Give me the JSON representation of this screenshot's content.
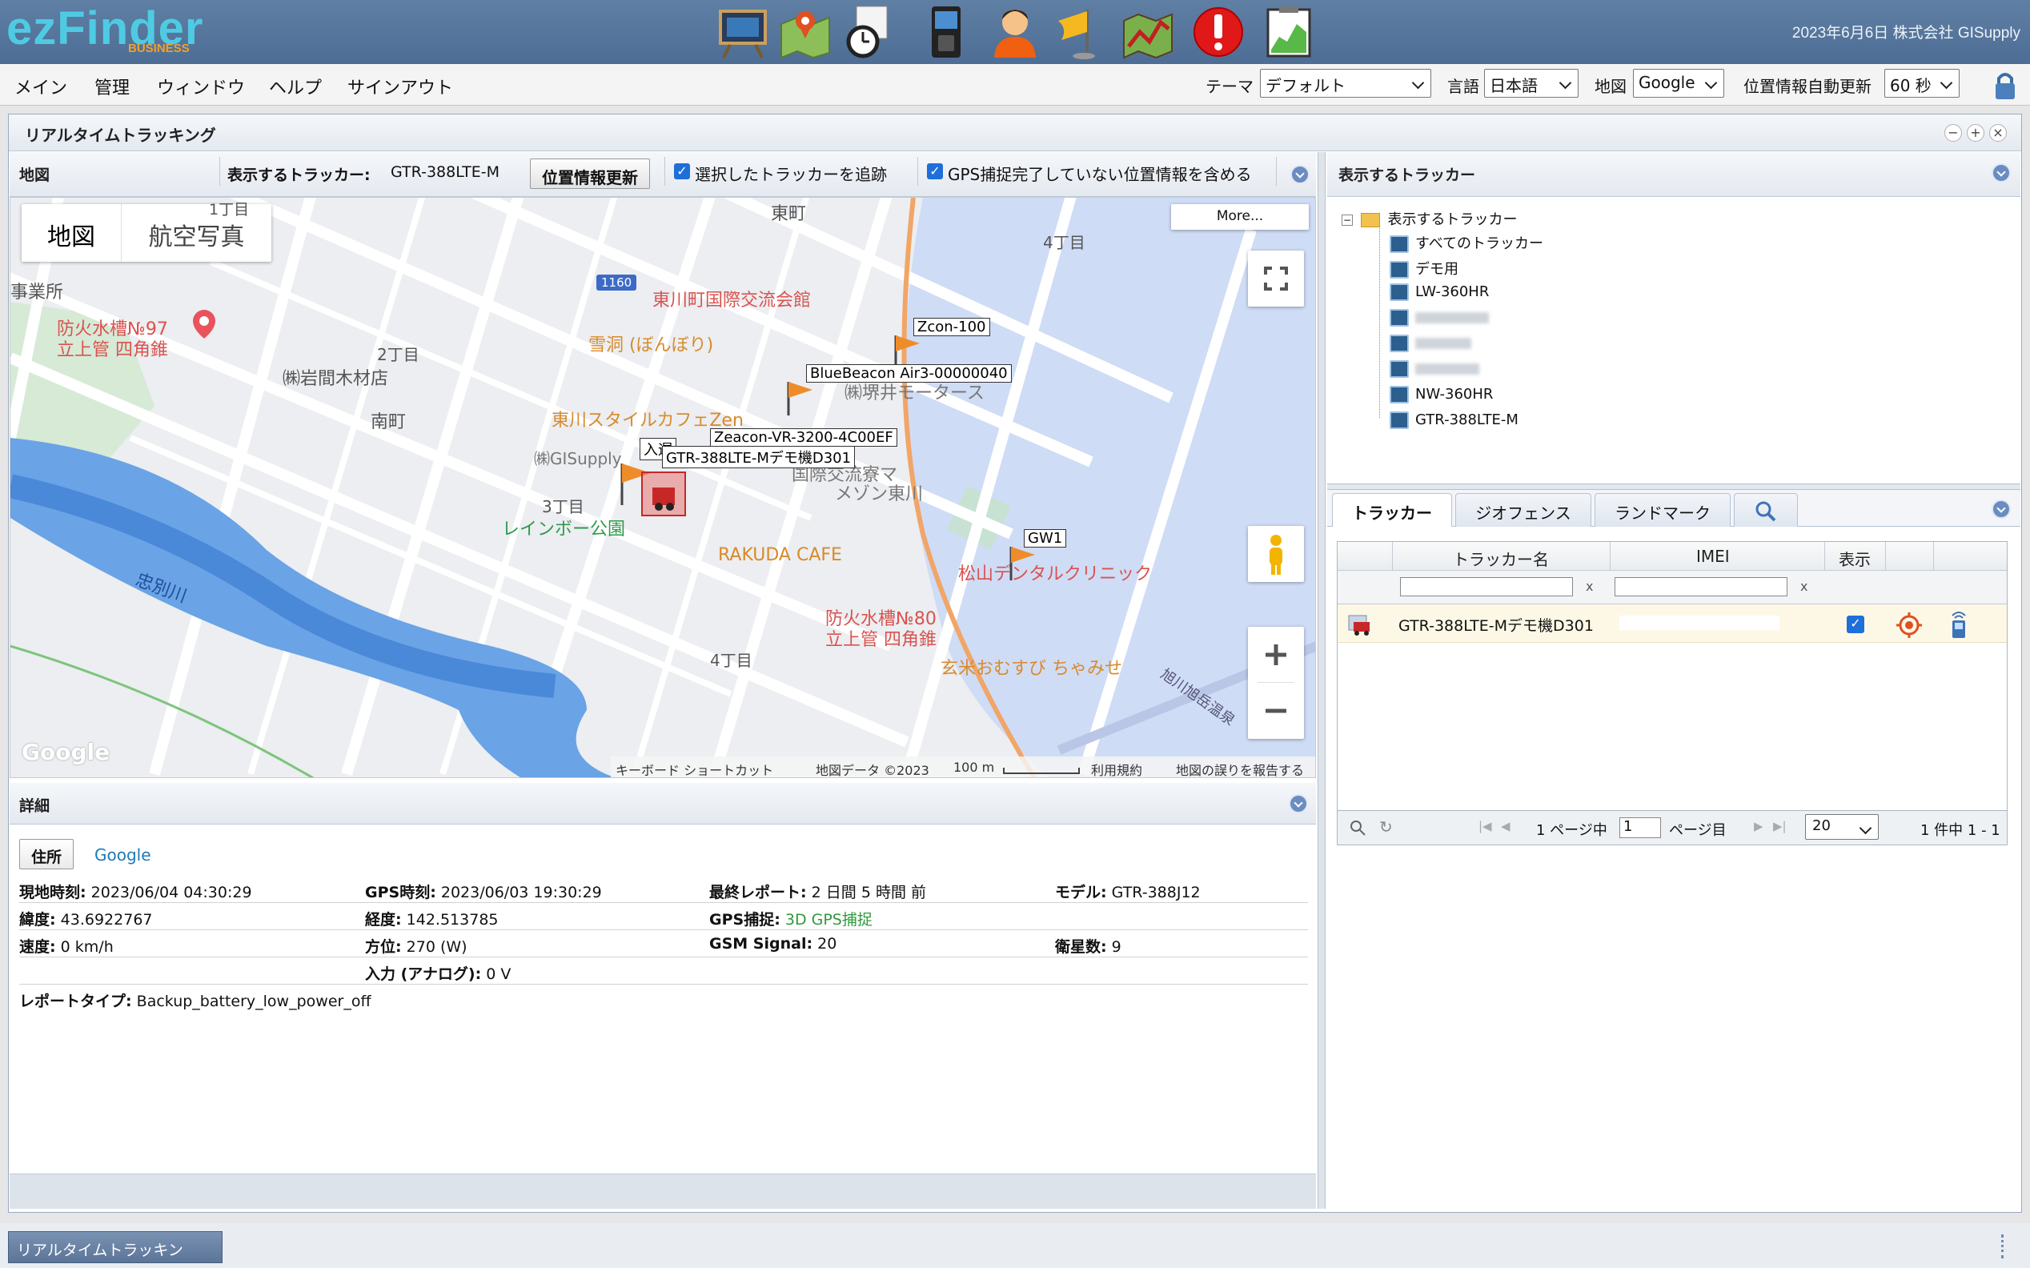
{
  "header": {
    "logo": "ezFinder",
    "logo_sub": "BUSINESS",
    "date_company": "2023年6月6日 株式会社 GISupply",
    "icons": [
      "presentation-board-icon",
      "map-pin-icon",
      "stopwatch-icon",
      "gps-device-icon",
      "user-icon",
      "flag-icon",
      "route-map-icon",
      "alert-icon",
      "chart-report-icon"
    ]
  },
  "menu": {
    "items": [
      "メイン",
      "管理",
      "ウィンドウ",
      "ヘルプ",
      "サインアウト"
    ],
    "theme_label": "テーマ",
    "theme_value": "デフォルト",
    "lang_label": "言語",
    "lang_value": "日本語",
    "map_label": "地図",
    "map_value": "Google",
    "refresh_label": "位置情報自動更新",
    "refresh_value": "60 秒"
  },
  "window": {
    "title": "リアルタイムトラッキング"
  },
  "map_panel": {
    "title": "地図",
    "tracker_label": "表示するトラッカー:",
    "tracker_value": "GTR-388LTE-M",
    "refresh_button": "位置情報更新",
    "follow_label": "選択したトラッカーを追跡",
    "include_label": "GPS捕捉完了していない位置情報を含める"
  },
  "map": {
    "type_map": "地図",
    "type_sat": "航空写真",
    "more": "More...",
    "places": {
      "higashimachi": "東町",
      "yonchome_ne": "4丁目",
      "itchome": "1丁目",
      "jigyousho": "事業所",
      "fire80_1": "防火水槽№97",
      "fire80_2": "立上管 四角錐",
      "nichome": "2丁目",
      "iwama": "㈱岩間木材店",
      "minamimachi": "南町",
      "kouryu": "東川町国際交流会館",
      "setsudou": "雪洞 (ぼんぼり)",
      "route1160": "1160",
      "cafezen": "東川スタイルカフェZen",
      "sakai": "㈱堺井モータース",
      "gisupply": "㈱GISupply",
      "kokusai": "国際交流寮マ",
      "maison": "メゾン東川",
      "sanchome": "3丁目",
      "rainbow": "レインボー公園",
      "rakuda": "RAKUDA CAFE",
      "matsuyama": "松山デンタルクリニック",
      "chubetsu": "忠別川",
      "fire80b_1": "防火水槽№80",
      "fire80b_2": "立上管 四角錐",
      "yonchome": "4丁目",
      "genmai": "玄米おむすび ちゃみせ",
      "asahikawa": "旭川旭岳温泉"
    },
    "flags": {
      "zcon": "Zcon-100",
      "blue": "BlueBeacon Air3-00000040",
      "zeacon": "Zeacon-VR-3200-4C00EF",
      "gtr": "GTR-388LTE-Mデモ機D301",
      "nyu": "入遅",
      "gw": "GW1"
    },
    "google": "Google",
    "footer": [
      "キーボード ショートカット",
      "地図データ ©2023",
      "100 m",
      "利用規約",
      "地図の誤りを報告する"
    ]
  },
  "details": {
    "title": "詳細",
    "btn_address": "住所",
    "link_google": "Google",
    "rows": [
      [
        [
          "現地時刻:",
          "2023/06/04 04:30:29"
        ],
        [
          "GPS時刻:",
          "2023/06/03 19:30:29"
        ],
        [
          "最終レポート:",
          "2 日間 5 時間 前"
        ],
        [
          "モデル:",
          "GTR-388J12"
        ]
      ],
      [
        [
          "緯度:",
          "43.6922767"
        ],
        [
          "経度:",
          "142.513785"
        ],
        [
          "GPS捕捉:",
          "3D GPS捕捉"
        ],
        [
          "",
          ""
        ]
      ],
      [
        [
          "速度:",
          "0 km/h"
        ],
        [
          "方位:",
          "270 (W)"
        ],
        [
          "GSM Signal:",
          "20"
        ],
        [
          "衛星数:",
          "9"
        ]
      ],
      [
        [
          "",
          ""
        ],
        [
          "入力 (アナログ):",
          "0 V"
        ],
        [
          "",
          ""
        ],
        [
          "",
          ""
        ]
      ]
    ],
    "report_label": "レポートタイプ:",
    "report_value": "Backup_battery_low_power_off"
  },
  "tree_panel": {
    "title": "表示するトラッカー",
    "root": "表示するトラッカー",
    "items": [
      "すべてのトラッカー",
      "デモ用",
      "LW-360HR",
      "NW-360HR",
      "GTR-388LTE-M"
    ]
  },
  "tabs": {
    "tracker": "トラッカー",
    "geofence": "ジオフェンス",
    "landmark": "ランドマーク"
  },
  "grid": {
    "col_name": "トラッカー名",
    "col_imei": "IMEI",
    "col_show": "表示",
    "filter_x": "x",
    "row_name": "GTR-388LTE-Mデモ機D301",
    "pager_page_prefix": "1 ページ中",
    "pager_page_value": "1",
    "pager_page_suffix": "ページ目",
    "pager_size": "20",
    "pager_count": "1 件中 1 - 1"
  },
  "taskbar": {
    "item": "リアルタイムトラッキン"
  }
}
